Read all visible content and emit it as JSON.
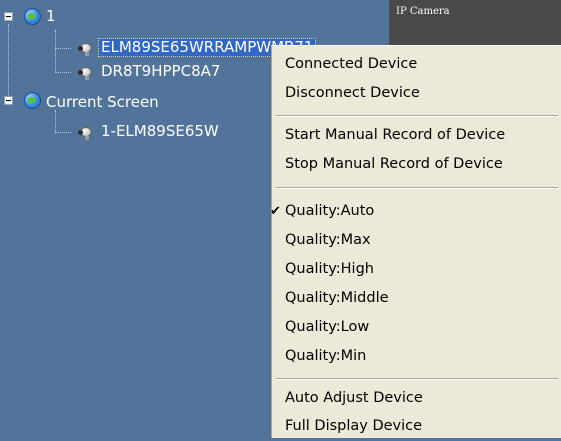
{
  "camera_panel": {
    "label": "IP Camera"
  },
  "tree": {
    "group1": {
      "label": "1",
      "icon": "globe-icon"
    },
    "device1": {
      "label": "ELM89SE65WRRAMPWMB71",
      "icon": "camera-icon",
      "selected": true
    },
    "device2": {
      "label": "DR8T9HPPC8A7",
      "icon": "camera-icon"
    },
    "group2": {
      "label": "Current Screen",
      "icon": "globe-icon"
    },
    "device3": {
      "label": "1-ELM89SE65W",
      "icon": "camera-icon"
    }
  },
  "context_menu": {
    "connect": "Connected Device",
    "disconnect": "Disconnect Device",
    "start_record": "Start Manual Record of Device",
    "stop_record": "Stop Manual Record of Device",
    "quality_auto": "Quality:Auto",
    "quality_max": "Quality:Max",
    "quality_high": "Quality:High",
    "quality_middle": "Quality:Middle",
    "quality_low": "Quality:Low",
    "quality_min": "Quality:Min",
    "auto_adjust": "Auto Adjust Device",
    "full_display": "Full Display Device",
    "checked_mark": "✔",
    "checked_item": "Quality:Auto"
  },
  "colors": {
    "tree_background": "#52749a",
    "selection": "#3167c6",
    "menu_background": "#ece9d8",
    "camera_panel": "#494949"
  }
}
